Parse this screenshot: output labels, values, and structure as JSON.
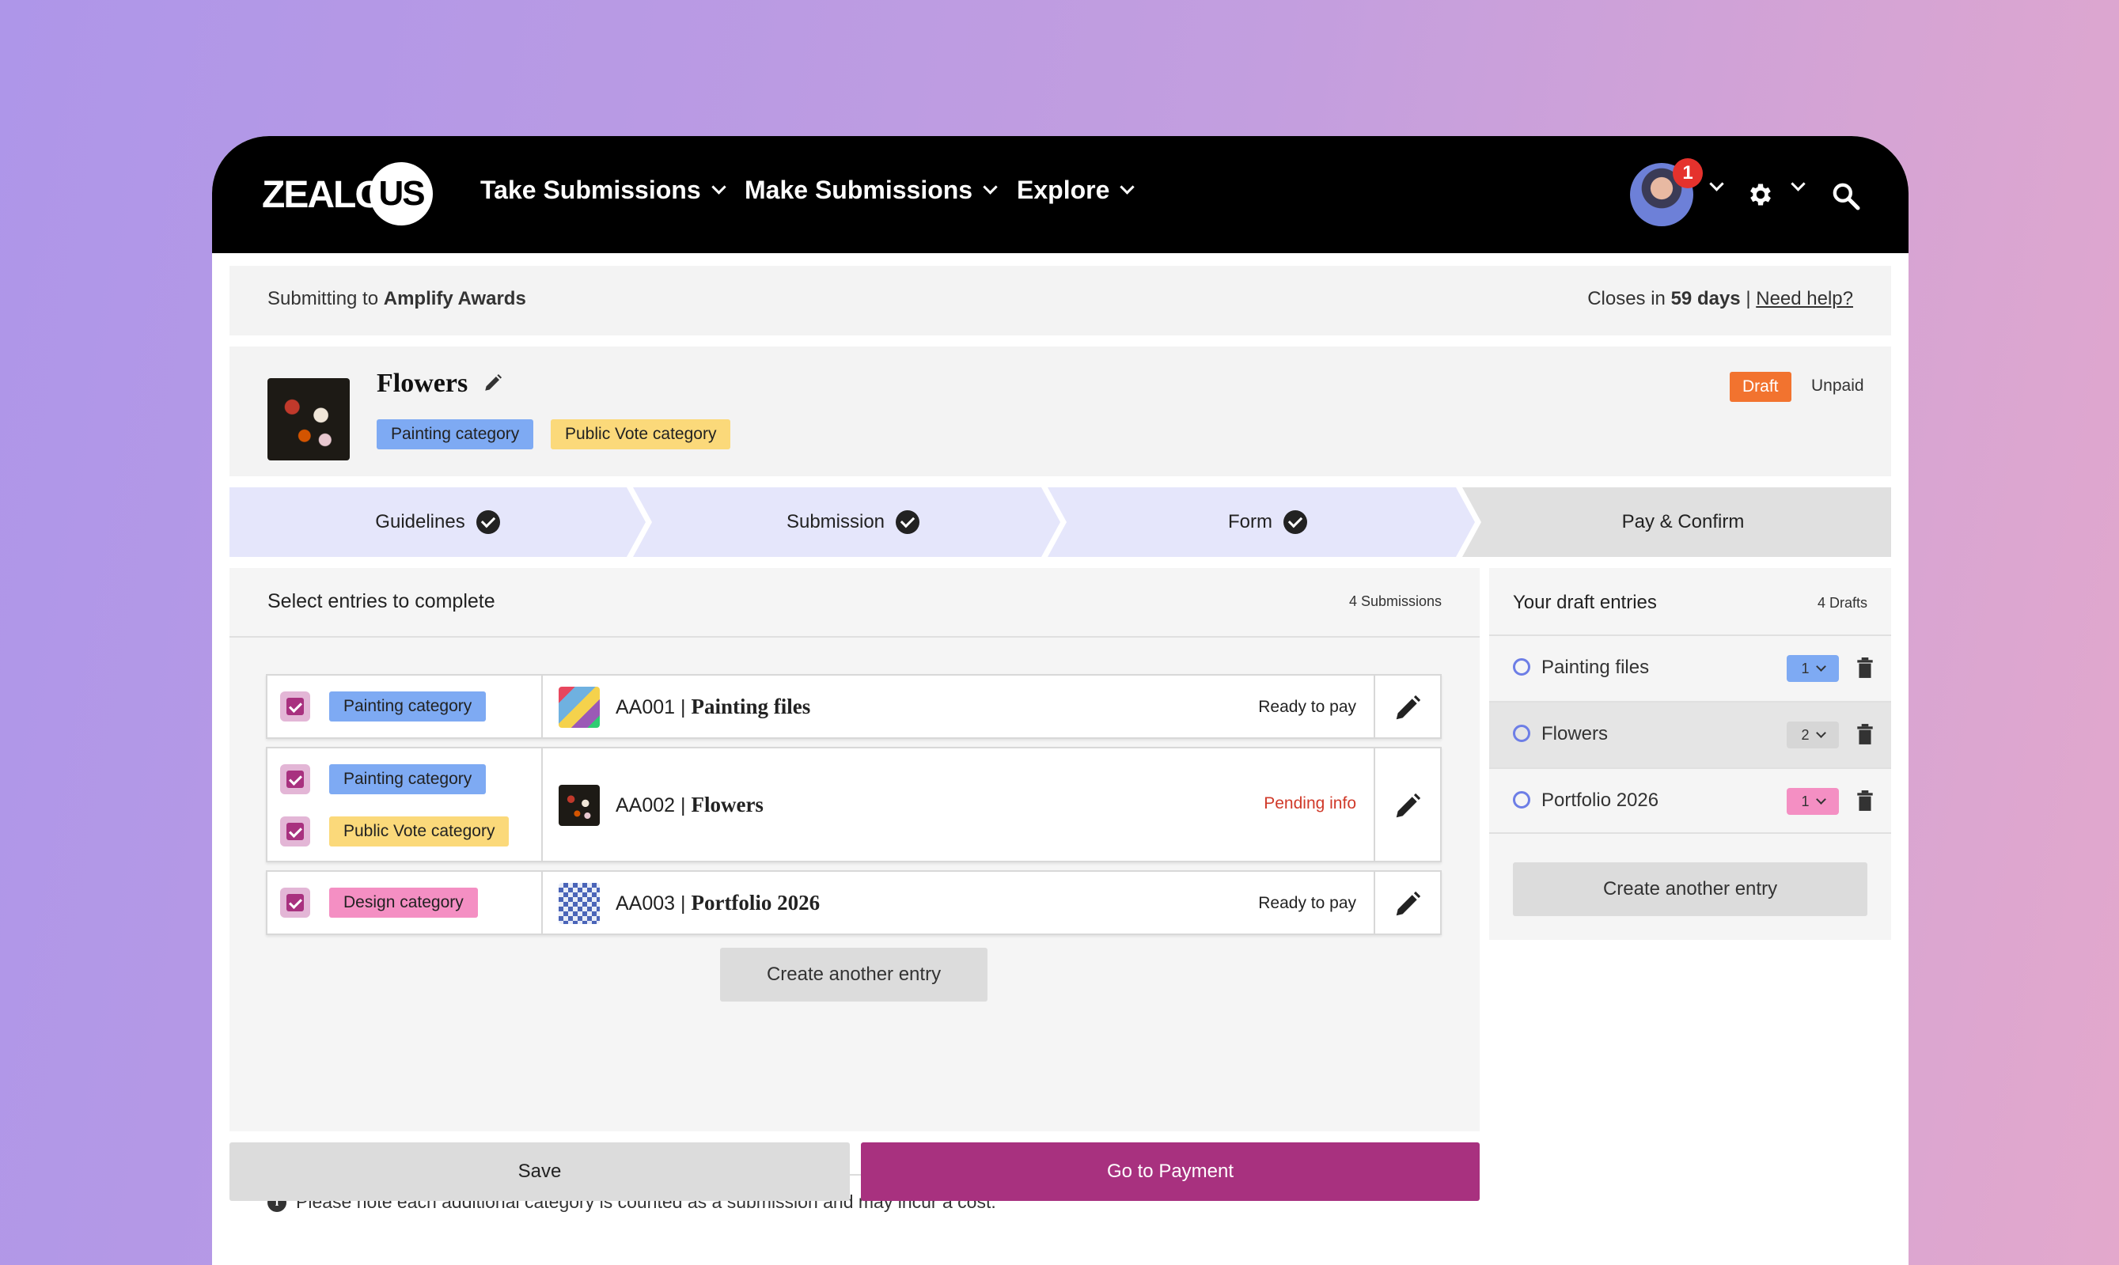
{
  "nav": {
    "logo_left": "ZEALO",
    "logo_right": "US",
    "items": [
      {
        "label": "Take Submissions"
      },
      {
        "label": "Make Submissions"
      },
      {
        "label": "Explore"
      }
    ],
    "notification_count": "1"
  },
  "subbar": {
    "prefix": "Submitting to",
    "program": "Amplify Awards",
    "closes_prefix": "Closes in",
    "closes_value": "59 days",
    "separator": "|",
    "help": "Need help?"
  },
  "entry": {
    "title": "Flowers",
    "tags": [
      "Painting category",
      "Public Vote category"
    ],
    "status": "Draft",
    "payment": "Unpaid"
  },
  "steps": [
    {
      "label": "Guidelines",
      "done": true
    },
    {
      "label": "Submission",
      "done": true
    },
    {
      "label": "Form",
      "done": true
    },
    {
      "label": "Pay & Confirm",
      "done": false
    }
  ],
  "entries_panel": {
    "heading": "Select entries to complete",
    "count": "4 Submissions",
    "rows": [
      {
        "categories": [
          "Painting category"
        ],
        "code": "AA001",
        "sep": "|",
        "name": "Painting files",
        "status": "Ready to pay"
      },
      {
        "categories": [
          "Painting category",
          "Public Vote category"
        ],
        "code": "AA002",
        "sep": "|",
        "name": "Flowers",
        "status": "Pending info"
      },
      {
        "categories": [
          "Design category"
        ],
        "code": "AA003",
        "sep": "|",
        "name": "Portfolio 2026",
        "status": "Ready to pay"
      }
    ],
    "create_button": "Create another entry",
    "note": "Please note each additional category is counted as a submission and may incur a cost."
  },
  "drafts_panel": {
    "heading": "Your draft entries",
    "count": "4 Drafts",
    "items": [
      {
        "name": "Painting files",
        "qty": "1",
        "color": "#7eaaf3"
      },
      {
        "name": "Flowers",
        "qty": "2",
        "color": "#d6d6d6"
      },
      {
        "name": "Portfolio 2026",
        "qty": "1",
        "color": "#f48fc3"
      }
    ],
    "create_button": "Create another entry"
  },
  "actions": {
    "save": "Save",
    "pay": "Go to Payment"
  },
  "colors": {
    "accent": "#a8317f",
    "draft": "#f2732f",
    "pending": "#d03a2a",
    "step_active": "#e5e6fb",
    "step_inactive": "#e0e0e0"
  }
}
